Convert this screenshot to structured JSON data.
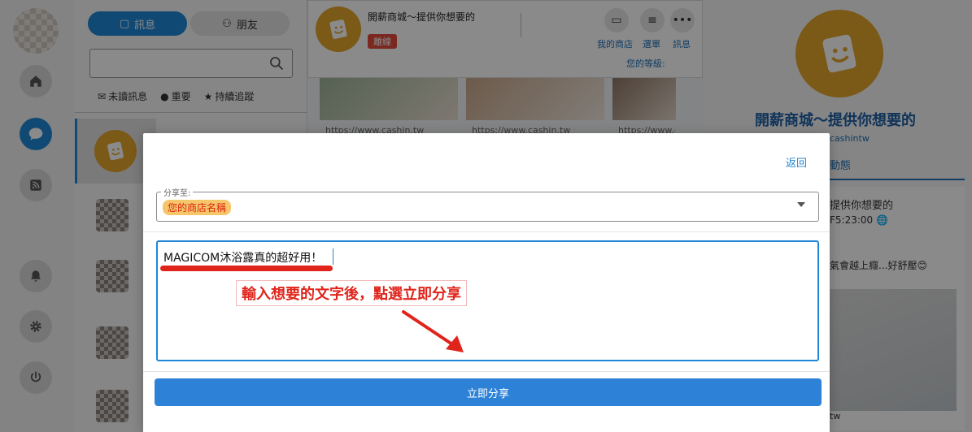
{
  "chat_tabs": {
    "messages": "訊息",
    "friends": "朋友"
  },
  "search": {
    "placeholder": ""
  },
  "filters": [
    {
      "label": "未讀訊息",
      "icon": "envelope-icon"
    },
    {
      "label": "重要",
      "icon": "info-icon"
    },
    {
      "label": "持續追蹤",
      "icon": "star-icon"
    }
  ],
  "shop": {
    "name": "開薪商城～提供你想要的",
    "status": "離線",
    "level_label": "您的等級:"
  },
  "header_actions": [
    {
      "label": "我的商店",
      "icon": "monitor-icon"
    },
    {
      "label": "選單",
      "icon": "menu-icon"
    },
    {
      "label": "訊息",
      "icon": "more-icon"
    }
  ],
  "thumbnails": [
    {
      "url": "https://www.cashin.tw"
    },
    {
      "url": "https://www.cashin.tw"
    },
    {
      "url": "https://www.cashin.tw"
    }
  ],
  "profile": {
    "name": "開薪商城～提供你想要的",
    "handle": "cashintw",
    "tab": "動態",
    "post_title": "提供你想要的",
    "post_time": "F5:23:00",
    "post_text": "氣會越上癮...好舒壓😊",
    "footer_text": "tw"
  },
  "modal": {
    "back_label": "返回",
    "share_to_label": "分享至:",
    "share_to_value": "您的商店名稱",
    "message_text": "MAGICOM沐浴露真的超好用！",
    "annotation": "輸入想要的文字後，點選立即分享",
    "submit_label": "立即分享"
  },
  "colors": {
    "primary": "#1f87d6",
    "brand": "#e3a42c",
    "alert": "#e0241b"
  }
}
